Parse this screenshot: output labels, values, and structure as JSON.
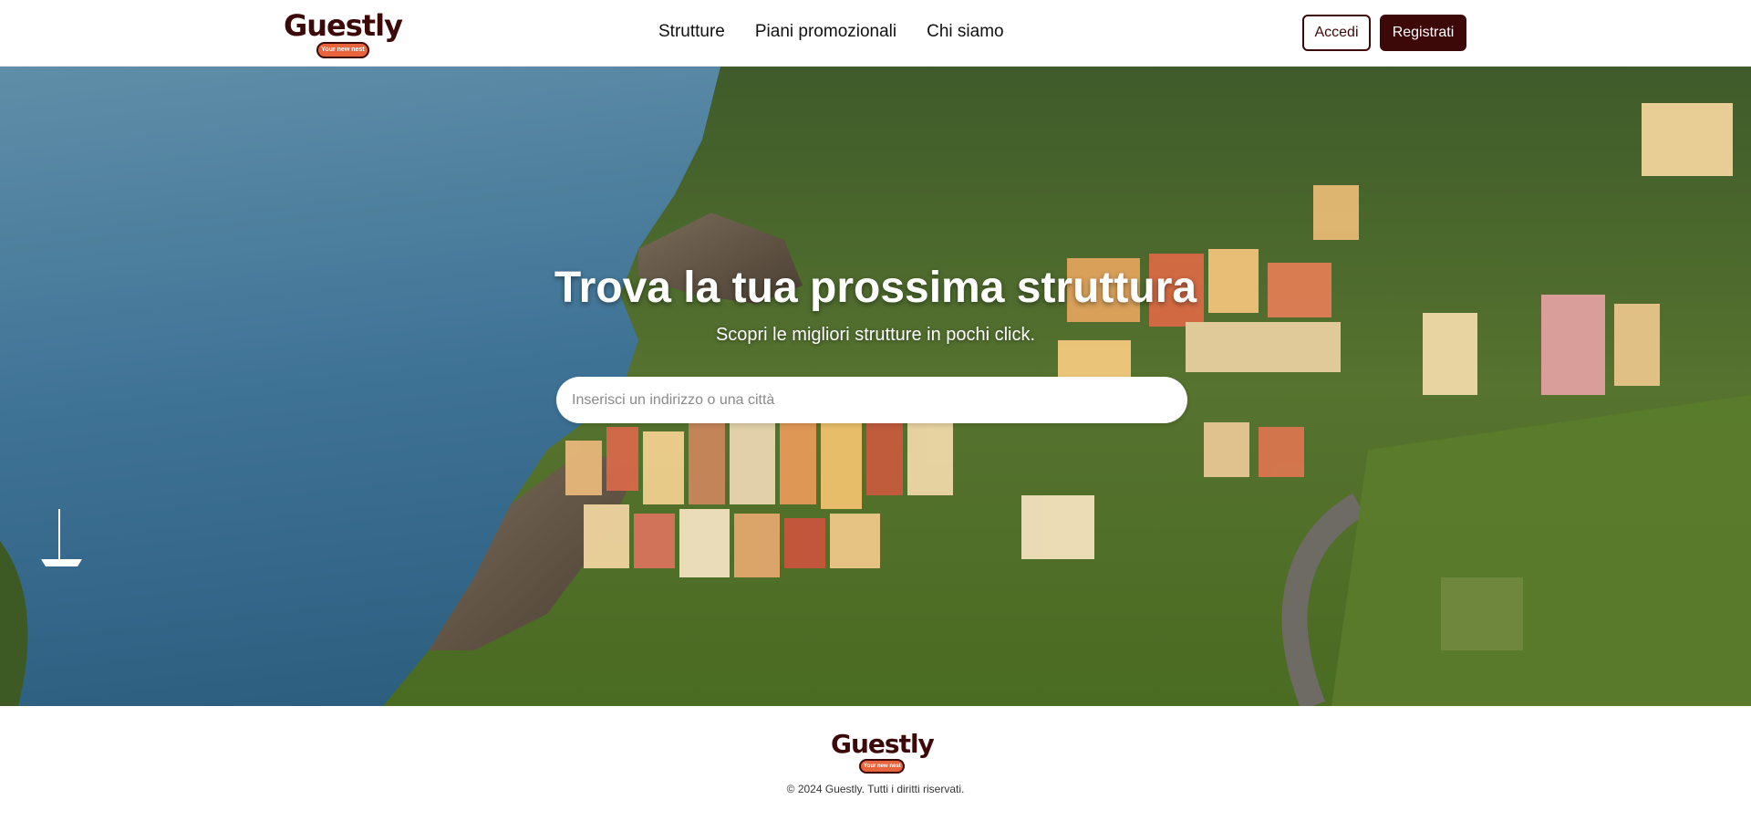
{
  "brand": {
    "name": "Guestly",
    "tagline": "Your new nest",
    "primary_color": "#3d0808",
    "accent_color": "#e8643d"
  },
  "nav": {
    "items": [
      {
        "label": "Strutture"
      },
      {
        "label": "Piani promozionali"
      },
      {
        "label": "Chi siamo"
      }
    ]
  },
  "auth": {
    "login_label": "Accedi",
    "register_label": "Registrati"
  },
  "hero": {
    "title": "Trova la tua prossima struttura",
    "subtitle": "Scopri le migliori strutture in pochi click.",
    "search_placeholder": "Inserisci un indirizzo o una città",
    "search_value": ""
  },
  "footer": {
    "copyright": "© 2024 Guestly. Tutti i diritti riservati."
  }
}
